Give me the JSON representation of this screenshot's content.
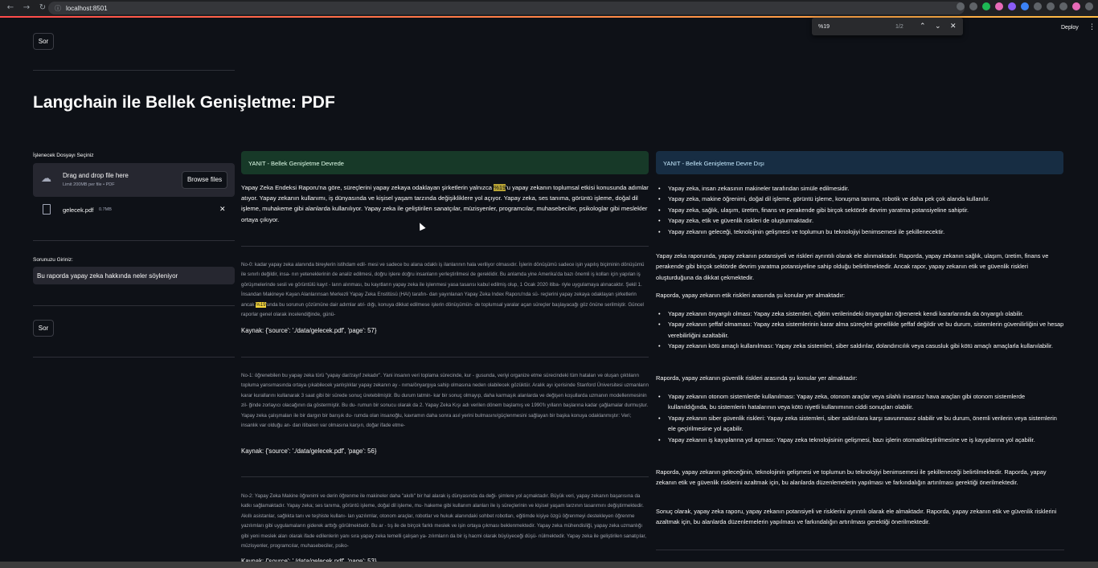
{
  "browser": {
    "url": "localhost:8501",
    "find_query": "%19",
    "find_count": "1/2"
  },
  "header": {
    "deploy_label": "Deploy",
    "menu_icon": "⋮"
  },
  "top_button": {
    "label": "Sor"
  },
  "title": "Langchain ile Bellek Genişletme: PDF",
  "sidebar": {
    "file_label": "İşlenecek Dosyayı Seçiniz",
    "dropzone_title": "Drag and drop file here",
    "dropzone_limit": "Limit 200MB per file • PDF",
    "browse_label": "Browse files",
    "file_name": "gelecek.pdf",
    "file_size": "0.7MB",
    "question_label": "Sorunuzu Giriniz:",
    "question_value": "Bu raporda yapay zeka hakkında neler söyleniyor",
    "ask_label": "Sor"
  },
  "left_col": {
    "alert": "YANIT - Bellek Genişletme Devrede",
    "answer_pre": "Yapay Zeka Endeksi Raporu'na göre, süreçlerini yapay zekaya odaklayan şirketlerin yalnızca ",
    "answer_hl": "%19",
    "answer_post": "'u yapay zekanın toplumsal etkisi konusunda adımlar atıyor. Yapay zekanın kullanımı, iş dünyasında ve kişisel yaşam tarzında değişikliklere yol açıyor. Yapay zeka, ses tanıma, görüntü işleme, doğal dil işleme, muhakeme gibi alanlarda kullanılıyor. Yapay zeka ile geliştirilen sanatçılar, müzisyenler, programcılar, muhasebeciler, psikologlar gibi meslekler ortaya çıkıyor.",
    "chunk0_pre": "No-0: kadar yapay zeka alanında bireylerin istihdam edil- mesi ve sadece bu alana odaklı iş ilanlarının hala veriliyor olmasıdır. İşlerin dönüşümü sadece işin yapılış biçiminin dönüşümü ile sınırlı değildir, insa- nın yeteneklerinin de analiz edilmesi, doğru işlere doğru insanların yerleştirilmesi de gereklidir. Bu anlamda yine Amerika'da bazı önemli iş kolları için yapılan iş görüşmelerinde sesli ve görüntülü kayıt - ların alınması, bu kayıtların yapay zeka ile işlenmesi yasa tasarısı kabul edilmiş olup, 1 Ocak 2020 itiba- riyle uygulamaya alınacaktır. Şekil 1. İnsandan Makineye Kayan Alanlarınsan Merkezli Yapay Zeka Enstitüsü (HAI) tarafın- dan yayınlanan Yapay Zeka Index Raporu'nda sü- reçlerini yapay zekaya odaklayan şirketlerin ancak ",
    "chunk0_hl": "%19",
    "chunk0_post": "'unda bu sorunun çözümüne dair adımlar atıl- dığı, konuya dikkat edilmese işlerin dönüşümün- de toplumsal yaralar açan süreçler başlayacağı göz önüne serilmiştir. Güncel raporlar genel olarak incelendiğinde, günü-",
    "source0": "Kaynak: {'source': './data/gelecek.pdf', 'page': 57}",
    "chunk1": "No-1: öğrenebilen bu yapay zeka türü \"yapay dar/zayıf zekadır\". Yani insanın veri toplama sürecinde, kur - gusunda, veriyi organize etme sürecindeki tüm hataları ve oluşan çıktıların topluma yansımasında ortaya çıkabilecek yanlışlıklar yapay zekanın ay - nıma/önyargıya sahip olmasına neden olabilecek gözüktür. Aralık ayı içerisinde Stanford Üniversitesi uzmanların karar kurallarını kullanarak 3 saat gibi bir sürede sonuç üretebilmiştir. Bu durum tatmin- kar bir sonuç olmayıp, daha karmaşık alanlarda ve değişen koşullarda uzmanın modellenmesinin zil- ğinde zorlayıcı olacağının da göstermiştir. Bu du- rumun bir sonucu olarak da 2. Yapay Zeka Kışı adı verilen dönem başlamış ve 1990'lı yılların başlarına kadar çağlamalar durmuştur. Yapay zeka çalışmaları ile bir dargın bir barışık du- rumda olan insanoğlu, kavramın daha sonra asıl yerini bulmasını/güçlenmesini sağlayan bir başka konuya odaklanmıştır: Veri; insanlık var olduğu an- dan itibaren var olmasına karşın, doğar ifade etme-",
    "source1": "Kaynak: {'source': './data/gelecek.pdf', 'page': 56}",
    "chunk2": "No-2: Yapay Zeka Makine öğrenimi ve derin öğrenme ile makineler daha \"akıllı\" bir hal alarak iş dünyasında da deği- şimlere yol açmaktadır. Büyük veri, yapay zekanın başarısına da katkı sağlamaktadır. Yapay zeka; ses tanıma, görüntü işleme, doğal dil işleme, mu- hakeme gibi kullanım alanları ile iş süreçlerinin ve kişisel yaşam tarzının tasarımını değiştirmektedir. Akıllı asistanlar, sağlıkta tanı ve teşhiste kullanı- lan yazılımlar, otonom araçlar, robotlar ve hukuk alanındaki sohbet robotları, eğitimde kişiye özgü öğrenmeyi destekleyen öğrenme yazılımları gibi uygulamaların giderek arttığı görülmektedir. Bu ar - tış ile de birçok farklı meslek ve işin ortaya çıkması beklenmektedir. Yapay zeka mühendisliği, yapay zeka uzmanlığı gibi yeni meslek aları olarak ifade edilenlerin yanı sıra yapay zeka temelli çalışan ya- zılımların da bir iş hacmi olarak büyüyeceği düşü- nülmektedir. Yapay zeka ile geliştirilen sanatçılar, müzisyenler, programcılar, muhasebeciler, psiko-",
    "source2": "Kaynak: {'source': './data/gelecek.pdf', 'page': 53}"
  },
  "right_col": {
    "alert": "YANIT - Bellek Genişletme Devre Dışı",
    "list1": [
      "Yapay zeka, insan zekasının makineler tarafından simüle edilmesidir.",
      "Yapay zeka, makine öğrenimi, doğal dil işleme, görüntü işleme, konuşma tanıma, robotik ve daha pek çok alanda kullanılır.",
      "Yapay zeka, sağlık, ulaşım, üretim, finans ve perakende gibi birçok sektörde devrim yaratma potansiyeline sahiptir.",
      "Yapay zeka, etik ve güvenlik riskleri de oluşturmaktadır.",
      "Yapay zekanın geleceği, teknolojinin gelişmesi ve toplumun bu teknolojiyi benimsemesi ile şekillenecektir."
    ],
    "para1": "Yapay zeka raporunda, yapay zekanın potansiyeli ve riskleri ayrıntılı olarak ele alınmaktadır. Raporda, yapay zekanın sağlık, ulaşım, üretim, finans ve perakende gibi birçok sektörde devrim yaratma potansiyeline sahip olduğu belirtilmektedir. Ancak rapor, yapay zekanın etik ve güvenlik riskleri oluşturduğuna da dikkat çekmektedir.",
    "para2": "Raporda, yapay zekanın etik riskleri arasında şu konular yer almaktadır:",
    "list2": [
      "Yapay zekanın önyargılı olması: Yapay zeka sistemleri, eğitim verilerindeki önyargıları öğrenerek kendi kararlarında da önyargılı olabilir.",
      "Yapay zekanın şeffaf olmaması: Yapay zeka sistemlerinin karar alma süreçleri genellikle şeffaf değildir ve bu durum, sistemlerin güvenilirliğini ve hesap verebilirliğini azaltabilir.",
      "Yapay zekanın kötü amaçlı kullanılması: Yapay zeka sistemleri, siber saldırılar, dolandırıcılık veya casusluk gibi kötü amaçlı amaçlarla kullanılabilir."
    ],
    "para3": "Raporda, yapay zekanın güvenlik riskleri arasında şu konular yer almaktadır:",
    "list3": [
      "Yapay zekanın otonom sistemlerde kullanılması: Yapay zeka, otonom araçlar veya silahlı insansız hava araçları gibi otonom sistemlerde kullanıldığında, bu sistemlerin hatalarının veya kötü niyetli kullanımının ciddi sonuçları olabilir.",
      "Yapay zekanın siber güvenlik riskleri: Yapay zeka sistemleri, siber saldırılara karşı savunmasız olabilir ve bu durum, önemli verilerin veya sistemlerin ele geçirilmesine yol açabilir.",
      "Yapay zekanın iş kayıplarına yol açması: Yapay zeka teknolojisinin gelişmesi, bazı işlerin otomatikleştirilmesine ve iş kayıplarına yol açabilir."
    ],
    "para4": "Raporda, yapay zekanın geleceğinin, teknolojinin gelişmesi ve toplumun bu teknolojiyi benimsemesi ile şekilleneceği belirtilmektedir. Raporda, yapay zekanın etik ve güvenlik risklerini azaltmak için, bu alanlarda düzenlemelerin yapılması ve farkındalığın artırılması gerektiği önerilmektedir.",
    "para5": "Sonuç olarak, yapay zeka raporu, yapay zekanın potansiyeli ve risklerini ayrıntılı olarak ele almaktadır. Raporda, yapay zekanın etik ve güvenlik risklerini azaltmak için, bu alanlarda düzenlemelerin yapılması ve farkındalığın artırılması gerektiği önerilmektedir."
  }
}
